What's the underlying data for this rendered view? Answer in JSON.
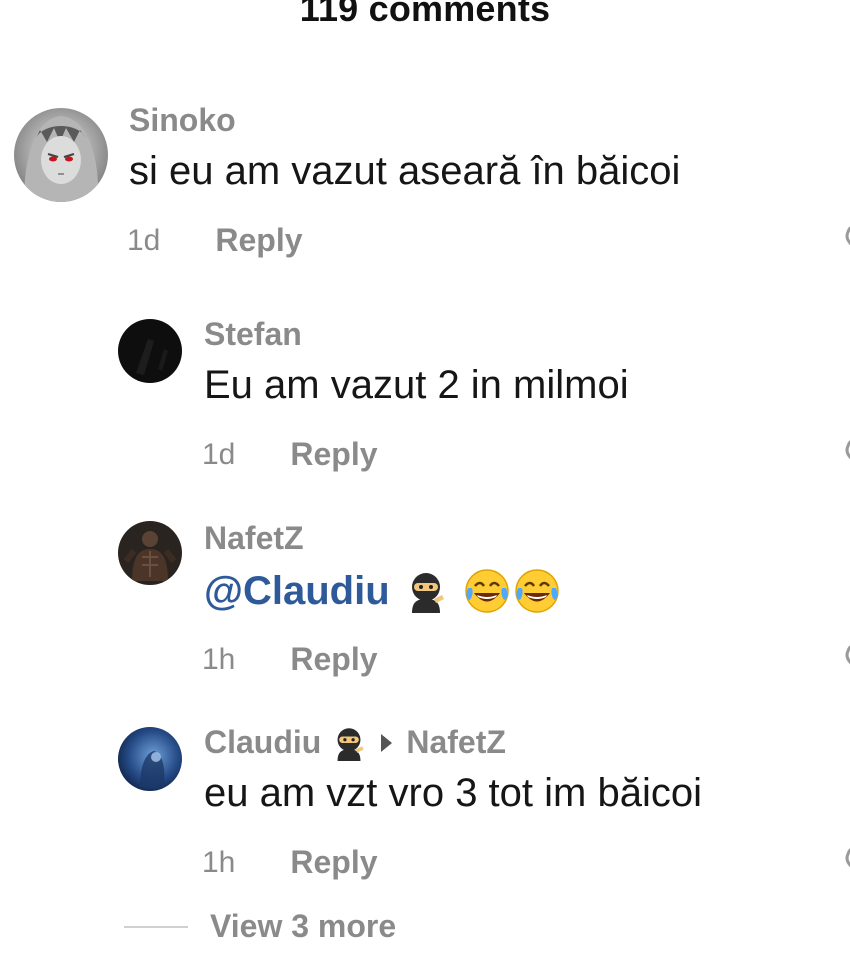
{
  "header": {
    "title": "119 comments"
  },
  "comments": [
    {
      "username": "Sinoko",
      "text": "si eu am vazut aseară în băicoi",
      "time": "1d",
      "reply_label": "Reply"
    },
    {
      "username": "Stefan",
      "text": "Eu am vazut 2 in milmoi",
      "time": "1d",
      "reply_label": "Reply"
    },
    {
      "username": "NafetZ",
      "mention": "@Claudiu",
      "time": "1h",
      "reply_label": "Reply",
      "emojis": [
        "ninja",
        "tears-of-joy",
        "tears-of-joy"
      ]
    },
    {
      "username": "Claudiu",
      "reply_to": "NafetZ",
      "text": "eu am vzt vro 3 tot im băicoi",
      "time": "1h",
      "reply_label": "Reply",
      "emojis": [
        "ninja"
      ]
    }
  ],
  "view_more": {
    "label": "View 3 more"
  },
  "colors": {
    "mention": "#2f5a9a",
    "muted": "#8a8a8a",
    "text": "#161616"
  }
}
